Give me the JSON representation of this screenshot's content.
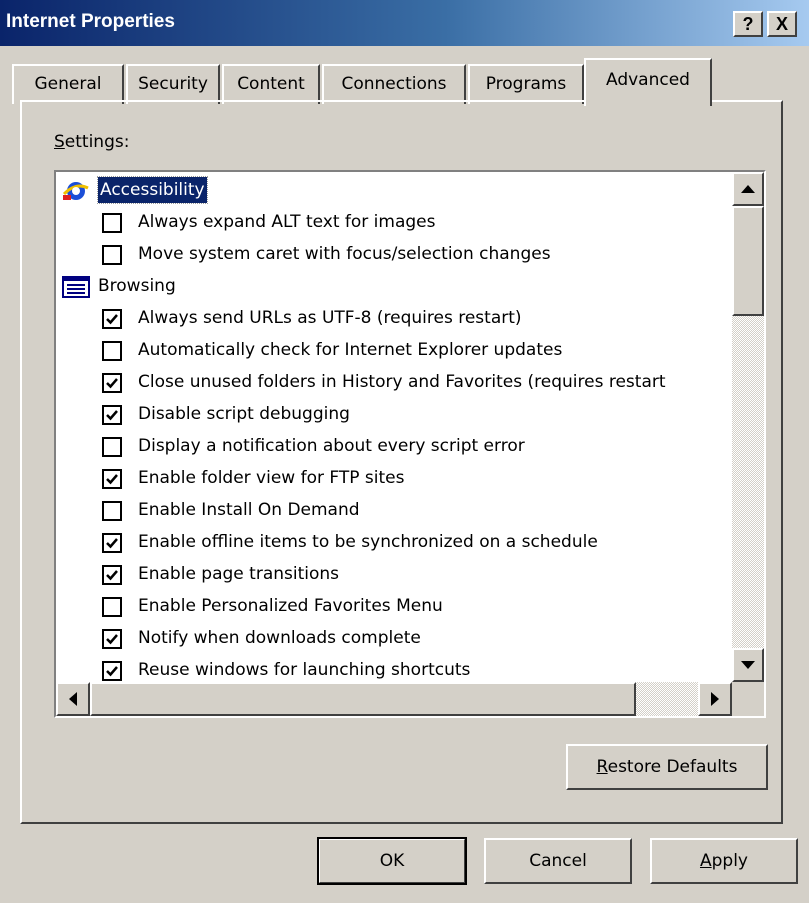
{
  "window": {
    "title": "Internet Properties",
    "help": "?",
    "close": "X"
  },
  "tabs": [
    {
      "label": "General",
      "active": false
    },
    {
      "label": "Security",
      "active": false
    },
    {
      "label": "Content",
      "active": false
    },
    {
      "label": "Connections",
      "active": false
    },
    {
      "label": "Programs",
      "active": false
    },
    {
      "label": "Advanced",
      "active": true
    }
  ],
  "settings": {
    "label_mnemonic": "S",
    "label_rest": "ettings:",
    "groups": [
      {
        "label": "Accessibility",
        "icon": "accessibility-icon",
        "selected": true,
        "items": [
          {
            "label": "Always expand ALT text for images",
            "checked": false
          },
          {
            "label": "Move system caret with focus/selection changes",
            "checked": false
          }
        ]
      },
      {
        "label": "Browsing",
        "icon": "browsing-icon",
        "selected": false,
        "items": [
          {
            "label": "Always send URLs as UTF-8 (requires restart)",
            "checked": true
          },
          {
            "label": "Automatically check for Internet Explorer updates",
            "checked": false
          },
          {
            "label": "Close unused folders in History and Favorites (requires restart",
            "checked": true
          },
          {
            "label": "Disable script debugging",
            "checked": true
          },
          {
            "label": "Display a notification about every script error",
            "checked": false
          },
          {
            "label": "Enable folder view for FTP sites",
            "checked": true
          },
          {
            "label": "Enable Install On Demand",
            "checked": false
          },
          {
            "label": "Enable offline items to be synchronized on a schedule",
            "checked": true
          },
          {
            "label": "Enable page transitions",
            "checked": true
          },
          {
            "label": "Enable Personalized Favorites Menu",
            "checked": false
          },
          {
            "label": "Notify when downloads complete",
            "checked": true
          },
          {
            "label": "Reuse windows for launching shortcuts",
            "checked": true
          }
        ]
      }
    ]
  },
  "buttons": {
    "restore_mnemonic": "R",
    "restore_rest": "estore Defaults",
    "ok": "OK",
    "cancel": "Cancel",
    "apply_mnemonic": "A",
    "apply_rest": "pply"
  }
}
